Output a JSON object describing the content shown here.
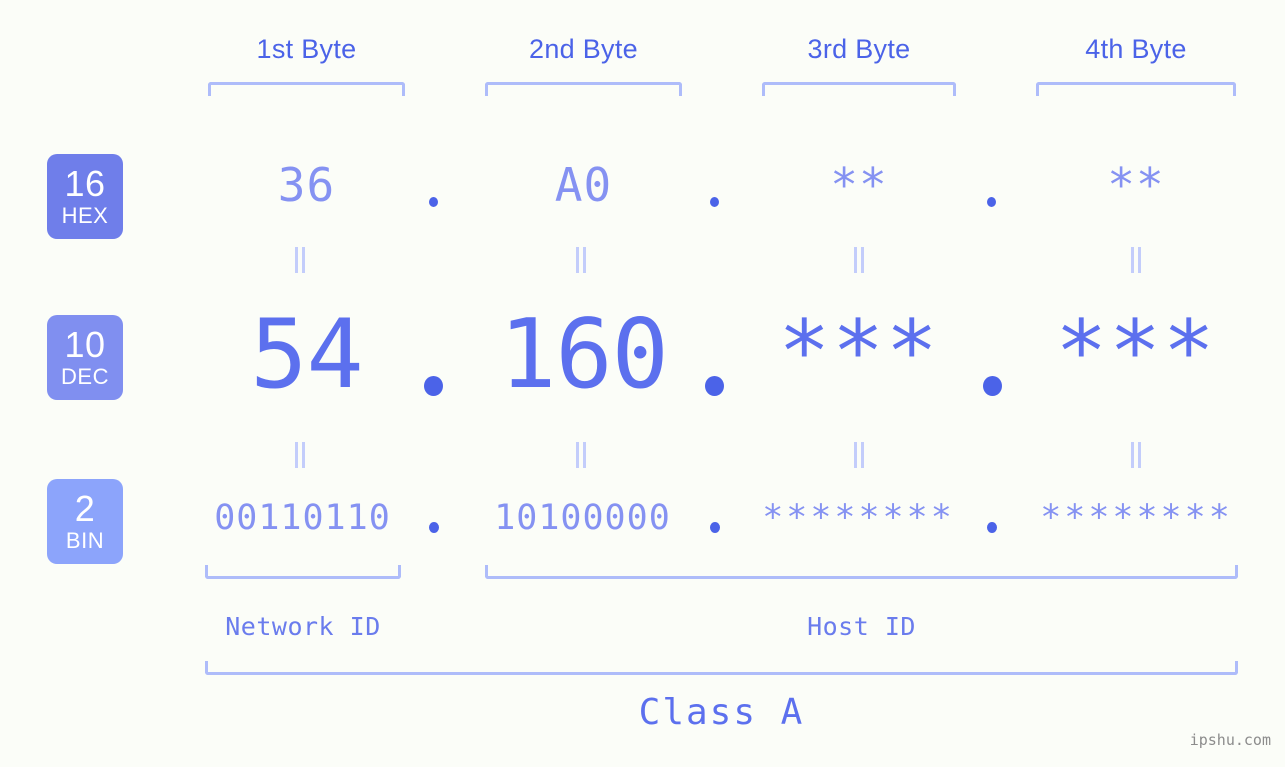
{
  "theme": {
    "background": "#fbfdf8",
    "accent_strong": "#4b63e8",
    "accent_mid": "#5c70ee",
    "accent_light": "#8592f2",
    "bracket": "#aebcfa",
    "eqmark": "#c3cdfb",
    "badge_hex_bg": "#6f7eea",
    "badge_dec_bg": "#808ff0",
    "badge_bin_bg": "#8ca4fb",
    "watermark_color": "#8c8c8c"
  },
  "byte_headers": [
    {
      "label": "1st Byte"
    },
    {
      "label": "2nd Byte"
    },
    {
      "label": "3rd Byte"
    },
    {
      "label": "4th Byte"
    }
  ],
  "radix_badges": [
    {
      "number": "16",
      "name": "HEX"
    },
    {
      "number": "10",
      "name": "DEC"
    },
    {
      "number": "2",
      "name": "BIN"
    }
  ],
  "rows": {
    "hex": {
      "radix": "16",
      "name": "HEX",
      "values": [
        "36",
        "A0",
        "**",
        "**"
      ]
    },
    "dec": {
      "radix": "10",
      "name": "DEC",
      "values": [
        "54",
        "160",
        "***",
        "***"
      ]
    },
    "bin": {
      "radix": "2",
      "name": "BIN",
      "values": [
        "00110110",
        "10100000",
        "********",
        "********"
      ]
    }
  },
  "separator": ".",
  "segments": {
    "network_id": "Network ID",
    "host_id": "Host ID"
  },
  "class_label": "Class A",
  "watermark": "ipshu.com"
}
